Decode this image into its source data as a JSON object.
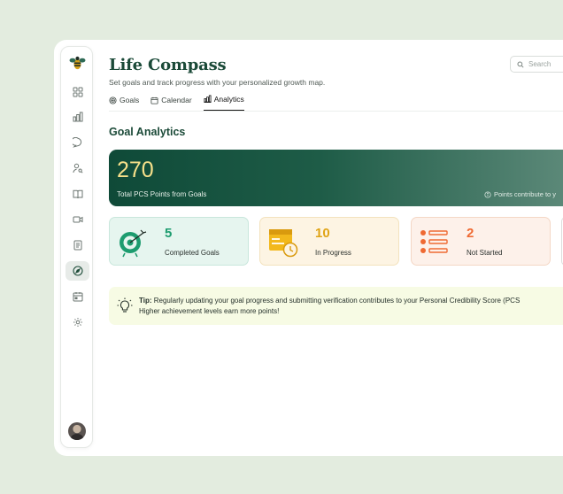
{
  "app": {
    "title": "Life Compass",
    "subtitle": "Set goals and track progress with your personalized growth map."
  },
  "search": {
    "placeholder": "Search"
  },
  "tabs": [
    {
      "label": "Goals",
      "icon": "target-icon",
      "active": false
    },
    {
      "label": "Calendar",
      "icon": "calendar-icon",
      "active": false
    },
    {
      "label": "Analytics",
      "icon": "bar-chart-icon",
      "active": true
    }
  ],
  "sidebar": {
    "items": [
      {
        "name": "dashboard-icon"
      },
      {
        "name": "chart-icon"
      },
      {
        "name": "chat-icon"
      },
      {
        "name": "user-search-icon"
      },
      {
        "name": "book-icon"
      },
      {
        "name": "video-icon"
      },
      {
        "name": "document-icon"
      },
      {
        "name": "compass-icon",
        "active": true
      },
      {
        "name": "calendar-icon"
      },
      {
        "name": "settings-icon"
      }
    ]
  },
  "section": {
    "title": "Goal Analytics"
  },
  "hero": {
    "value": "270",
    "label": "Total PCS Points from Goals",
    "note": "Points contribute to y"
  },
  "stats": [
    {
      "value": "5",
      "label": "Completed Goals",
      "color": "#1d9c6f"
    },
    {
      "value": "10",
      "label": "In Progress",
      "color": "#e0a416"
    },
    {
      "value": "2",
      "label": "Not Started",
      "color": "#ef6a33"
    }
  ],
  "tip": {
    "lead": "Tip:",
    "line1": "Regularly updating your goal progress and submitting verification contributes to your Personal Credibility Score (PCS",
    "line2": "Higher achievement levels earn more points!"
  },
  "colors": {
    "brand_green": "#1b4a38",
    "background": "#e3ecdf",
    "hero_value": "#f6e08a"
  }
}
